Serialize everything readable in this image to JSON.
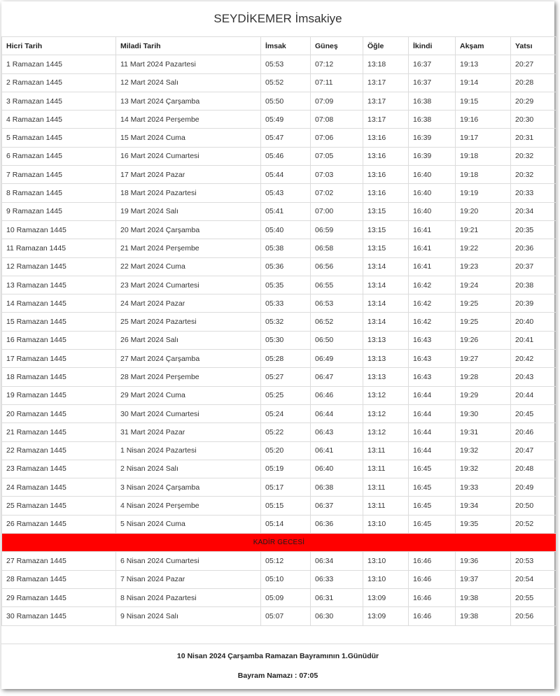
{
  "page": {
    "title": "SEYDİKEMER İmsakiye"
  },
  "colors": {
    "special_row": "#ff0000"
  },
  "table": {
    "headers": [
      "Hicri Tarih",
      "Miladi Tarih",
      "İmsak",
      "Güneş",
      "Öğle",
      "İkindi",
      "Akşam",
      "Yatsı"
    ],
    "rows_before": [
      [
        "1 Ramazan 1445",
        "11 Mart 2024 Pazartesi",
        "05:53",
        "07:12",
        "13:18",
        "16:37",
        "19:13",
        "20:27"
      ],
      [
        "2 Ramazan 1445",
        "12 Mart 2024 Salı",
        "05:52",
        "07:11",
        "13:17",
        "16:37",
        "19:14",
        "20:28"
      ],
      [
        "3 Ramazan 1445",
        "13 Mart 2024 Çarşamba",
        "05:50",
        "07:09",
        "13:17",
        "16:38",
        "19:15",
        "20:29"
      ],
      [
        "4 Ramazan 1445",
        "14 Mart 2024 Perşembe",
        "05:49",
        "07:08",
        "13:17",
        "16:38",
        "19:16",
        "20:30"
      ],
      [
        "5 Ramazan 1445",
        "15 Mart 2024 Cuma",
        "05:47",
        "07:06",
        "13:16",
        "16:39",
        "19:17",
        "20:31"
      ],
      [
        "6 Ramazan 1445",
        "16 Mart 2024 Cumartesi",
        "05:46",
        "07:05",
        "13:16",
        "16:39",
        "19:18",
        "20:32"
      ],
      [
        "7 Ramazan 1445",
        "17 Mart 2024 Pazar",
        "05:44",
        "07:03",
        "13:16",
        "16:40",
        "19:18",
        "20:32"
      ],
      [
        "8 Ramazan 1445",
        "18 Mart 2024 Pazartesi",
        "05:43",
        "07:02",
        "13:16",
        "16:40",
        "19:19",
        "20:33"
      ],
      [
        "9 Ramazan 1445",
        "19 Mart 2024 Salı",
        "05:41",
        "07:00",
        "13:15",
        "16:40",
        "19:20",
        "20:34"
      ],
      [
        "10 Ramazan 1445",
        "20 Mart 2024 Çarşamba",
        "05:40",
        "06:59",
        "13:15",
        "16:41",
        "19:21",
        "20:35"
      ],
      [
        "11 Ramazan 1445",
        "21 Mart 2024 Perşembe",
        "05:38",
        "06:58",
        "13:15",
        "16:41",
        "19:22",
        "20:36"
      ],
      [
        "12 Ramazan 1445",
        "22 Mart 2024 Cuma",
        "05:36",
        "06:56",
        "13:14",
        "16:41",
        "19:23",
        "20:37"
      ],
      [
        "13 Ramazan 1445",
        "23 Mart 2024 Cumartesi",
        "05:35",
        "06:55",
        "13:14",
        "16:42",
        "19:24",
        "20:38"
      ],
      [
        "14 Ramazan 1445",
        "24 Mart 2024 Pazar",
        "05:33",
        "06:53",
        "13:14",
        "16:42",
        "19:25",
        "20:39"
      ],
      [
        "15 Ramazan 1445",
        "25 Mart 2024 Pazartesi",
        "05:32",
        "06:52",
        "13:14",
        "16:42",
        "19:25",
        "20:40"
      ],
      [
        "16 Ramazan 1445",
        "26 Mart 2024 Salı",
        "05:30",
        "06:50",
        "13:13",
        "16:43",
        "19:26",
        "20:41"
      ],
      [
        "17 Ramazan 1445",
        "27 Mart 2024 Çarşamba",
        "05:28",
        "06:49",
        "13:13",
        "16:43",
        "19:27",
        "20:42"
      ],
      [
        "18 Ramazan 1445",
        "28 Mart 2024 Perşembe",
        "05:27",
        "06:47",
        "13:13",
        "16:43",
        "19:28",
        "20:43"
      ],
      [
        "19 Ramazan 1445",
        "29 Mart 2024 Cuma",
        "05:25",
        "06:46",
        "13:12",
        "16:44",
        "19:29",
        "20:44"
      ],
      [
        "20 Ramazan 1445",
        "30 Mart 2024 Cumartesi",
        "05:24",
        "06:44",
        "13:12",
        "16:44",
        "19:30",
        "20:45"
      ],
      [
        "21 Ramazan 1445",
        "31 Mart 2024 Pazar",
        "05:22",
        "06:43",
        "13:12",
        "16:44",
        "19:31",
        "20:46"
      ],
      [
        "22 Ramazan 1445",
        "1 Nisan 2024 Pazartesi",
        "05:20",
        "06:41",
        "13:11",
        "16:44",
        "19:32",
        "20:47"
      ],
      [
        "23 Ramazan 1445",
        "2 Nisan 2024 Salı",
        "05:19",
        "06:40",
        "13:11",
        "16:45",
        "19:32",
        "20:48"
      ],
      [
        "24 Ramazan 1445",
        "3 Nisan 2024 Çarşamba",
        "05:17",
        "06:38",
        "13:11",
        "16:45",
        "19:33",
        "20:49"
      ],
      [
        "25 Ramazan 1445",
        "4 Nisan 2024 Perşembe",
        "05:15",
        "06:37",
        "13:11",
        "16:45",
        "19:34",
        "20:50"
      ],
      [
        "26 Ramazan 1445",
        "5 Nisan 2024 Cuma",
        "05:14",
        "06:36",
        "13:10",
        "16:45",
        "19:35",
        "20:52"
      ]
    ],
    "special_row_label": "KADİR GECESİ",
    "rows_after": [
      [
        "27 Ramazan 1445",
        "6 Nisan 2024 Cumartesi",
        "05:12",
        "06:34",
        "13:10",
        "16:46",
        "19:36",
        "20:53"
      ],
      [
        "28 Ramazan 1445",
        "7 Nisan 2024 Pazar",
        "05:10",
        "06:33",
        "13:10",
        "16:46",
        "19:37",
        "20:54"
      ],
      [
        "29 Ramazan 1445",
        "8 Nisan 2024 Pazartesi",
        "05:09",
        "06:31",
        "13:09",
        "16:46",
        "19:38",
        "20:55"
      ],
      [
        "30 Ramazan 1445",
        "9 Nisan 2024 Salı",
        "05:07",
        "06:30",
        "13:09",
        "16:46",
        "19:38",
        "20:56"
      ]
    ]
  },
  "footer": {
    "bayram_text": "10 Nisan 2024 Çarşamba Ramazan Bayramının 1.Günüdür",
    "namaz_text": "Bayram Namazı : 07:05"
  }
}
